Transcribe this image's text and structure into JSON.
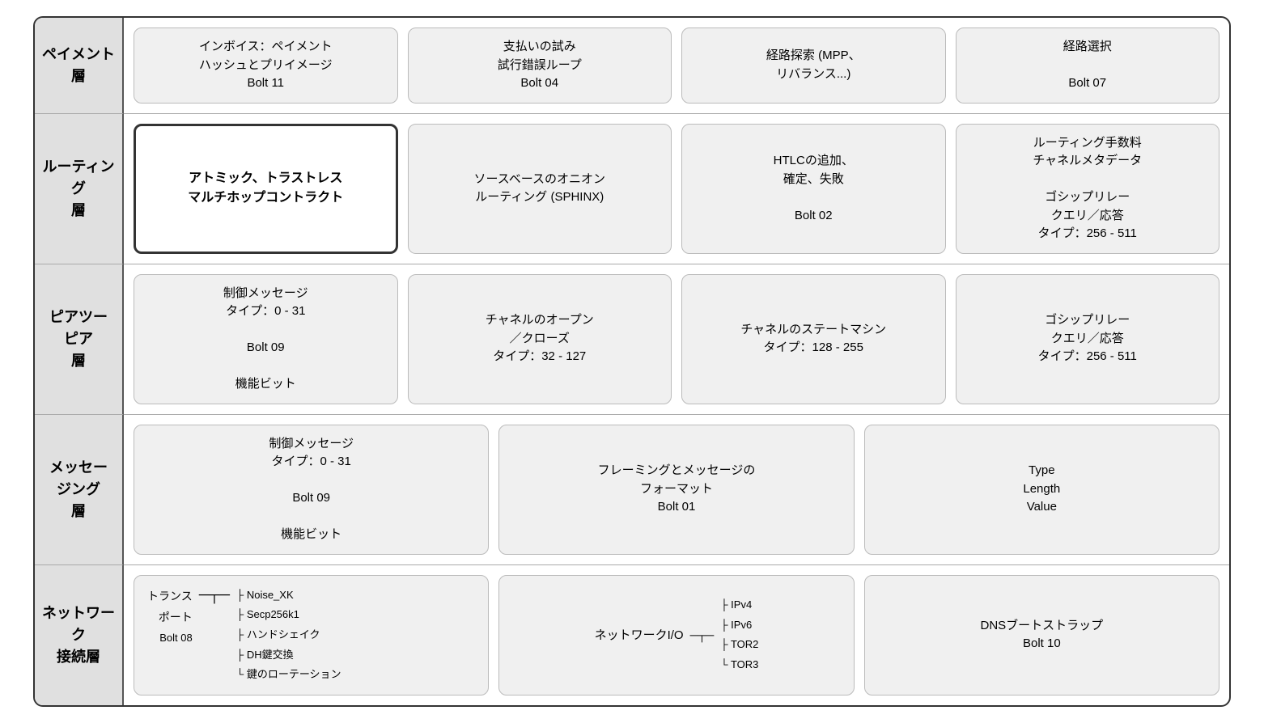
{
  "layers": {
    "payment": {
      "label": "ペイメント\n層",
      "cards": [
        {
          "id": "payment-c1",
          "lines": [
            "インボイス：ペイメント",
            "ハッシュとプリイメージ",
            "Bolt 11"
          ],
          "highlighted": false
        },
        {
          "id": "payment-c2",
          "lines": [
            "支払いの試み",
            "試行錯誤ループ",
            "Bolt 04"
          ],
          "highlighted": false
        },
        {
          "id": "payment-c3",
          "lines": [
            "経路探索 (MPP、",
            "リバランス...)",
            ""
          ],
          "highlighted": false
        },
        {
          "id": "payment-c4",
          "lines": [
            "経路選択",
            "",
            "Bolt 07"
          ],
          "highlighted": false
        }
      ]
    },
    "routing": {
      "label": "ルーティング\n層",
      "cards": [
        {
          "id": "routing-c1",
          "lines": [
            "アトミック、トラストレス",
            "マルチホップコントラクト"
          ],
          "highlighted": true
        },
        {
          "id": "routing-c2",
          "lines": [
            "ソースベースのオニオン",
            "ルーティング (SPHINX)"
          ],
          "highlighted": false
        },
        {
          "id": "routing-c3",
          "lines": [
            "HTLCの追加、",
            "確定、失敗",
            "Bolt 02"
          ],
          "highlighted": false
        },
        {
          "id": "routing-c4",
          "lines": [
            "ルーティング手数料",
            "チャネルメタデータ",
            "",
            "ゴシップリレー",
            "クエリ／応答",
            "タイプ：256 - 511"
          ],
          "highlighted": false
        }
      ]
    },
    "p2p": {
      "label": "ピアツー\nピア\n層",
      "cards": [
        {
          "id": "p2p-c1",
          "lines": [
            "制御メッセージ",
            "タイプ：0 - 31",
            "",
            "Bolt 09",
            "",
            "機能ビット"
          ],
          "highlighted": false
        },
        {
          "id": "p2p-c2",
          "lines": [
            "チャネルのオープン",
            "／クローズ",
            "タイプ：32 - 127"
          ],
          "highlighted": false
        },
        {
          "id": "p2p-c3",
          "lines": [
            "チャネルのステートマシン",
            "タイプ：128 - 255"
          ],
          "highlighted": false
        },
        {
          "id": "p2p-c4",
          "lines": [
            "ゴシップリレー",
            "クエリ／応答",
            "タイプ：256 - 511"
          ],
          "highlighted": false
        }
      ]
    },
    "messaging": {
      "label": "メッセー\nジング\n層",
      "cards": [
        {
          "id": "msg-c1",
          "lines": [
            "制御メッセージ",
            "タイプ：0 - 31",
            "",
            "Bolt 09",
            "",
            "機能ビット"
          ],
          "highlighted": false
        },
        {
          "id": "msg-c2",
          "lines": [
            "フレーミングとメッセージの",
            "フォーマット",
            "Bolt 01"
          ],
          "highlighted": false
        },
        {
          "id": "msg-c3",
          "lines": [
            "Type",
            "Length",
            "Value"
          ],
          "highlighted": false
        }
      ]
    },
    "network": {
      "label": "ネットワーク\n接続層",
      "transport_label": "トランス\nポート",
      "transport_bolt": "Bolt 08",
      "transport_items": [
        "Noise_XK",
        "Secp256k1",
        "ハンドシェイク",
        "DH鍵交換",
        "鍵のローテーション"
      ],
      "network_io_label": "ネットワークI/O",
      "network_io_items": [
        "IPv4",
        "IPv6",
        "TOR2",
        "TOR3"
      ],
      "dns_label": "DNSブートストラップ",
      "dns_bolt": "Bolt 10"
    }
  }
}
